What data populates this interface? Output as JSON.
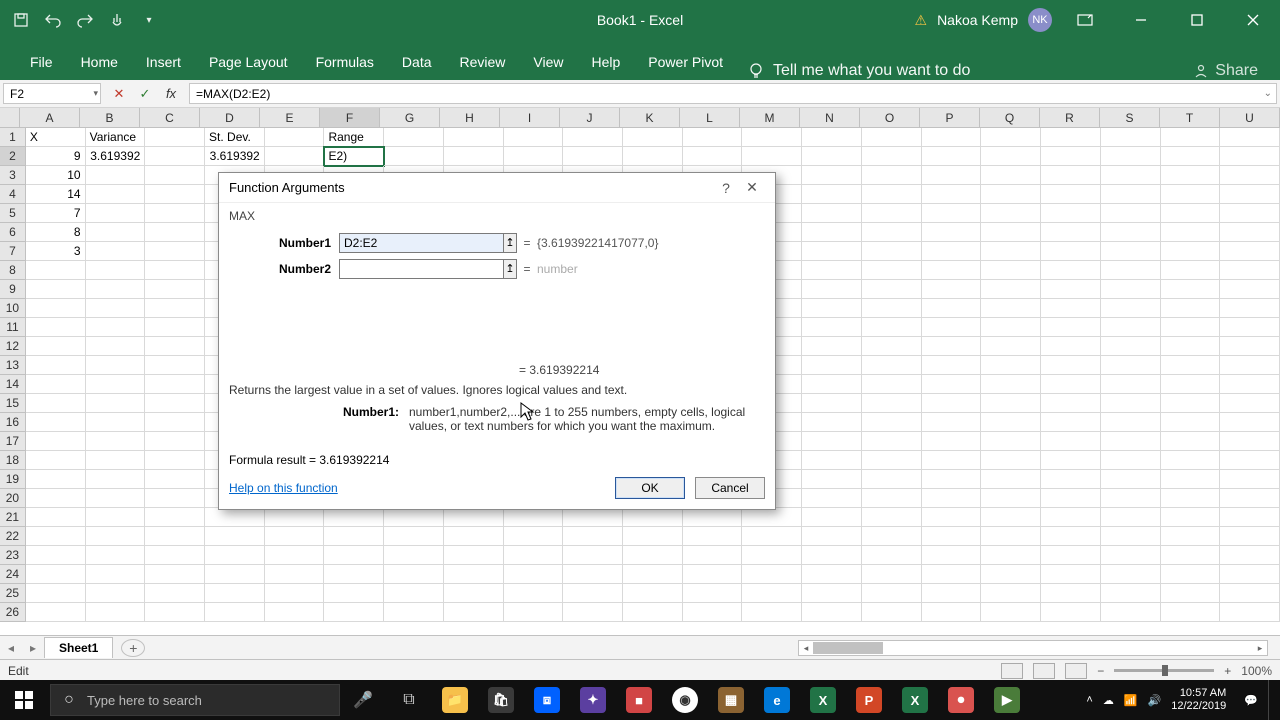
{
  "title": "Book1  -  Excel",
  "user": {
    "name": "Nakoa Kemp",
    "initials": "NK"
  },
  "ribbon": {
    "tabs": [
      "File",
      "Home",
      "Insert",
      "Page Layout",
      "Formulas",
      "Data",
      "Review",
      "View",
      "Help",
      "Power Pivot"
    ],
    "tellme": "Tell me what you want to do",
    "share": "Share"
  },
  "namebox": "F2",
  "formula": "=MAX(D2:E2)",
  "columns": [
    "A",
    "B",
    "C",
    "D",
    "E",
    "F",
    "G",
    "H",
    "I",
    "J",
    "K",
    "L",
    "M",
    "N",
    "O",
    "P",
    "Q",
    "R",
    "S",
    "T",
    "U"
  ],
  "activeCol": "F",
  "activeRow": 2,
  "rows": 26,
  "cells": {
    "A1": "X",
    "B1": "Variance",
    "D1": "St. Dev.",
    "F1": "Range",
    "A2": "9",
    "B2": "3.619392",
    "D2": "3.619392",
    "F2": "E2)",
    "A3": "10",
    "A4": "14",
    "A5": "7",
    "A6": "8",
    "A7": "3"
  },
  "dialog": {
    "title": "Function Arguments",
    "fn": "MAX",
    "arg1_label": "Number1",
    "arg1_value": "D2:E2",
    "arg1_result": "{3.61939221417077,0}",
    "arg2_label": "Number2",
    "arg2_value": "",
    "arg2_result": "number",
    "mid_result": "=  3.619392214",
    "desc": "Returns the largest value in a set of values. Ignores logical values and text.",
    "argdesc_label": "Number1:",
    "argdesc_text": "number1,number2,... are 1 to 255 numbers, empty cells, logical values, or text numbers for which you want the maximum.",
    "formula_result_label": "Formula result =  ",
    "formula_result": "3.619392214",
    "help": "Help on this function",
    "ok": "OK",
    "cancel": "Cancel"
  },
  "sheet": {
    "name": "Sheet1"
  },
  "status": {
    "mode": "Edit",
    "zoom": "100%"
  },
  "taskbar": {
    "search_placeholder": "Type here to search",
    "time": "10:57 AM",
    "date": "12/22/2019"
  }
}
